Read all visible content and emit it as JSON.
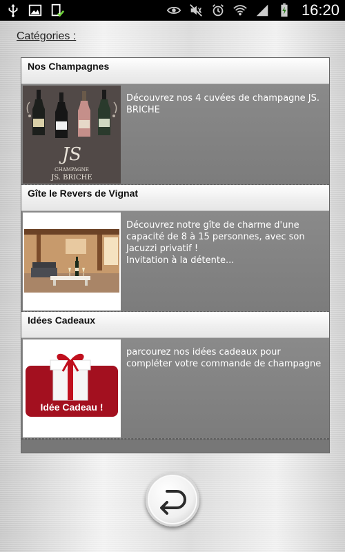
{
  "status_bar": {
    "time": "16:20",
    "left_icons": [
      "usb-icon",
      "image-icon",
      "download-check-icon"
    ],
    "right_icons": [
      "eye-icon",
      "mute-icon",
      "alarm-icon",
      "wifi-icon",
      "signal-icon",
      "battery-charging-icon"
    ]
  },
  "page": {
    "categories_label": "Catégories :"
  },
  "sections": [
    {
      "title": "Nos Champagnes",
      "description": "Découvrez nos 4 cuvées de champagne JS. BRICHE",
      "image": "champagne-bottles-image",
      "image_text": {
        "line1": "CHAMPAGNE",
        "line2": "JS. BRICHE",
        "mono": "JS"
      }
    },
    {
      "title": "Gîte le Revers de Vignat",
      "description": "Découvrez notre gîte de charme d'une capacité de 8 à 15 personnes, avec son Jacuzzi privatif !\nInvitation à la détente...",
      "image": "gite-living-room-image"
    },
    {
      "title": "Idées Cadeaux",
      "description": "parcourez nos idées cadeaux pour compléter votre commande de champagne",
      "image": "gift-idea-image",
      "image_text": {
        "caption": "Idée Cadeau !"
      }
    }
  ],
  "back_button": {
    "icon": "back-arrow-icon"
  },
  "colors": {
    "status_bar": "#000000",
    "row_background": "#7f7f7f",
    "gift_red": "#a01020"
  }
}
